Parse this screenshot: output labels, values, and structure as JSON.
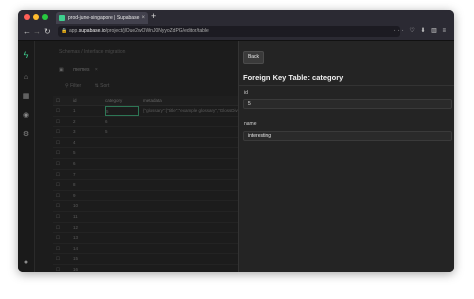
{
  "browser": {
    "tab_title": "prod-june-singapore | Supabase",
    "url_prefix": "app.",
    "url_host": "supabase.io",
    "url_path": "/project/jlOue2wOWnJ0NyyoZdPG/editor/table"
  },
  "editor": {
    "breadcrumb": "Schemas  /  Interface migration",
    "table_tab": "memes",
    "filter_label": "Filter",
    "sort_label": "Sort",
    "columns": [
      "id",
      "category",
      "metadata"
    ],
    "rows": [
      {
        "id": "1",
        "category": "5",
        "metadata": "{\"glossary\":{\"title\":\"example glossary\",\"GlossDiv\":{\"title\":\"S\",\"…"
      },
      {
        "id": "2",
        "category": "6",
        "metadata": ""
      },
      {
        "id": "3",
        "category": "5",
        "metadata": ""
      },
      {
        "id": "4",
        "category": "",
        "metadata": ""
      },
      {
        "id": "5",
        "category": "",
        "metadata": ""
      },
      {
        "id": "6",
        "category": "",
        "metadata": ""
      },
      {
        "id": "7",
        "category": "",
        "metadata": ""
      },
      {
        "id": "8",
        "category": "",
        "metadata": ""
      },
      {
        "id": "9",
        "category": "",
        "metadata": ""
      },
      {
        "id": "10",
        "category": "",
        "metadata": ""
      },
      {
        "id": "11",
        "category": "",
        "metadata": ""
      },
      {
        "id": "12",
        "category": "",
        "metadata": ""
      },
      {
        "id": "13",
        "category": "",
        "metadata": ""
      },
      {
        "id": "14",
        "category": "",
        "metadata": ""
      },
      {
        "id": "15",
        "category": "",
        "metadata": ""
      },
      {
        "id": "16",
        "category": "",
        "metadata": ""
      },
      {
        "id": "17",
        "category": "",
        "metadata": ""
      },
      {
        "id": "18",
        "category": "",
        "metadata": ""
      }
    ]
  },
  "panel": {
    "back_label": "Back",
    "title": "Foreign Key Table: category",
    "fields": [
      {
        "label": "id",
        "value": "5"
      },
      {
        "label": "name",
        "value": "interesting"
      }
    ]
  },
  "colors": {
    "accent": "#3ecf8e",
    "background": "#1c1c1c",
    "panel": "#242424"
  }
}
